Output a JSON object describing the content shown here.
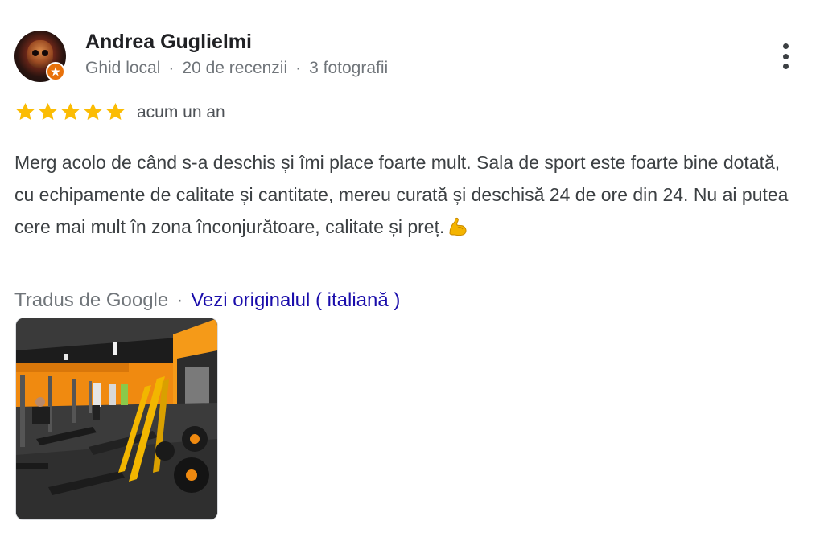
{
  "review": {
    "author": {
      "name": "Andrea Guglielmi",
      "role": "Ghid local",
      "reviews": "20 de recenzii",
      "photos": "3 fotografii",
      "separator": "·",
      "avatar_icon": "skull-avatar",
      "badge_icon": "local-guide-star-badge"
    },
    "rating": 5,
    "rating_max": 5,
    "time": "acum un an",
    "text": "Merg acolo de când s-a deschis și îmi place foarte mult. Sala de sport este foarte bine dotată, cu echipamente de calitate și cantitate, mereu curată și deschisă 24 de ore din 24. Nu ai putea cere mai mult în zona înconjurătoare, calitate și preț.",
    "text_emoji": "flexed-biceps",
    "translation": {
      "label": "Tradus de Google",
      "separator": "·",
      "link": "Vezi originalul ( italiană )"
    },
    "photo_icon": "gym-interior-photo",
    "more_icon": "more-vert-icon"
  },
  "colors": {
    "star": "#fbbc04",
    "link": "#1a0dab",
    "badge": "#e8710a",
    "gym_wall": "#f08a10"
  }
}
